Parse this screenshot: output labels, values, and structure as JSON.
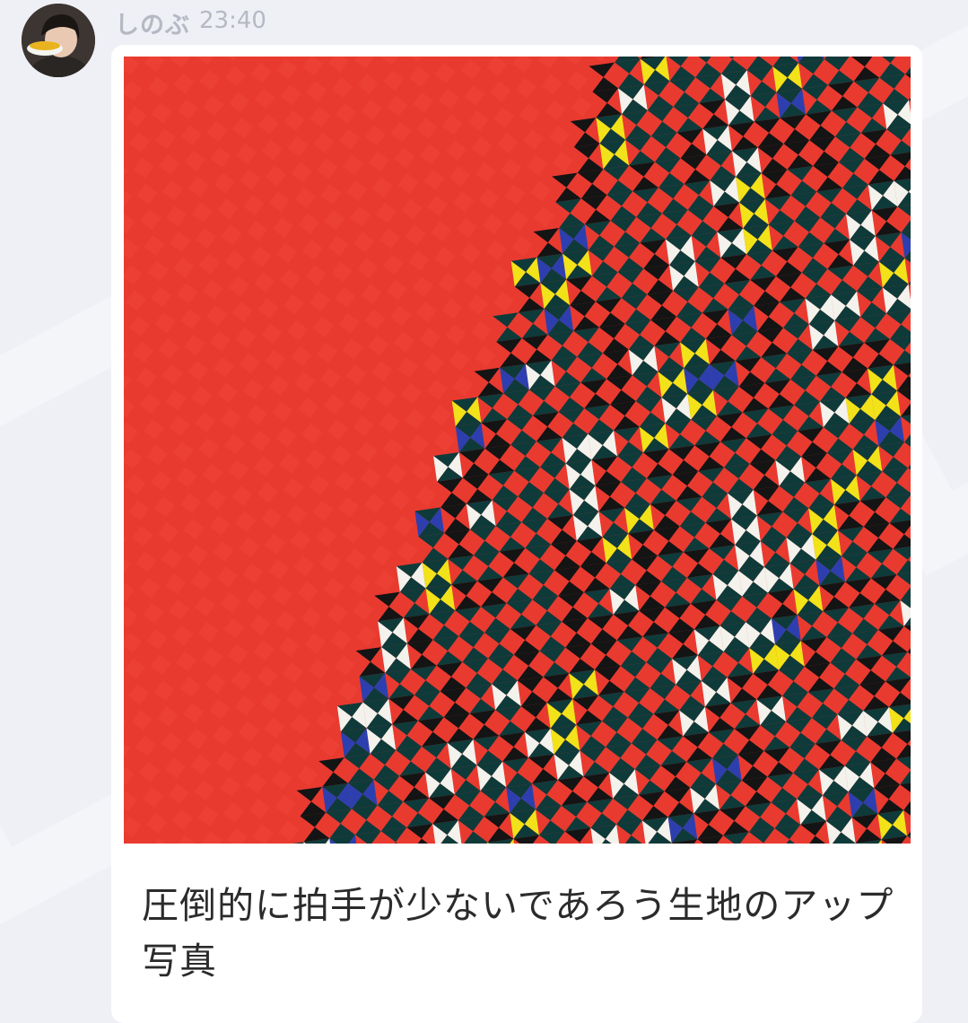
{
  "message": {
    "sender_name": "しのぶ",
    "timestamp": "23:40",
    "avatar_icon": "user-avatar-icon",
    "caption": "圧倒的に拍手が少ないであろう生地のアップ写真"
  },
  "photo": {
    "subject": "embroidered-fabric-photo",
    "colors": {
      "base_red": "#e93a30",
      "dark_teal": "#0f3a3a",
      "black": "#141414",
      "yellow": "#f2e21a",
      "white": "#f4f2ec",
      "blue": "#2d3fae"
    }
  }
}
